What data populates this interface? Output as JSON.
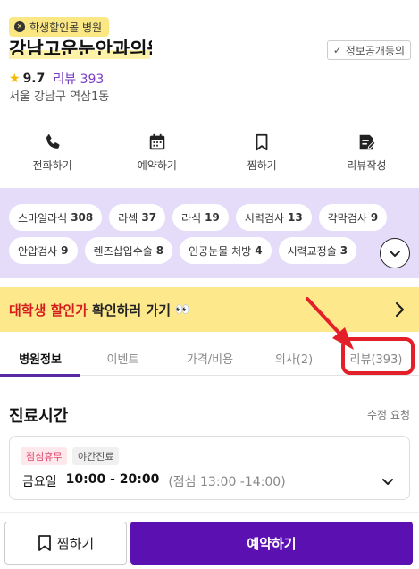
{
  "header": {
    "badge": "학생할인몰 병원",
    "name": "강남고운눈안과의원",
    "info_button": "정보공개동의",
    "rating": "9.7",
    "review_label": "리뷰 393",
    "address": "서울 강남구 역삼1동"
  },
  "actions": [
    {
      "label": "전화하기",
      "icon": "phone-icon"
    },
    {
      "label": "예약하기",
      "icon": "calendar-icon"
    },
    {
      "label": "찜하기",
      "icon": "bookmark-icon"
    },
    {
      "label": "리뷰작성",
      "icon": "review-write-icon"
    }
  ],
  "chips": {
    "row1": [
      {
        "name": "스마일라식",
        "count": "308"
      },
      {
        "name": "라섹",
        "count": "37"
      },
      {
        "name": "라식",
        "count": "19"
      },
      {
        "name": "시력검사",
        "count": "13"
      },
      {
        "name": "각막검사",
        "count": "9"
      }
    ],
    "row2": [
      {
        "name": "안압검사",
        "count": "9"
      },
      {
        "name": "렌즈삽입수술",
        "count": "8"
      },
      {
        "name": "인공눈물 처방",
        "count": "4"
      },
      {
        "name": "시력교정술",
        "count": "3"
      }
    ]
  },
  "banner": {
    "highlight": "대학생 할인가",
    "text": "확인하러 가기",
    "emoji": "👀"
  },
  "tabs": [
    {
      "label": "병원정보",
      "active": true
    },
    {
      "label": "이벤트",
      "active": false
    },
    {
      "label": "가격/비용",
      "active": false
    },
    {
      "label": "의사(2)",
      "active": false
    },
    {
      "label": "리뷰(393)",
      "active": false
    }
  ],
  "hours": {
    "title": "진료시간",
    "edit_link": "수정 요청",
    "tag_lunch": "점심휴무",
    "tag_night": "야간진료",
    "day": "금요일",
    "time": "10:00 - 20:00",
    "lunch": "(점심 13:00 -14:00)"
  },
  "bottom": {
    "bookmark_label": "찜하기",
    "book_label": "예약하기"
  },
  "colors": {
    "accent": "#5b10b2",
    "chips_bg": "#e4dcf8",
    "banner_bg": "#fde88c",
    "annotation": "#e3202a"
  }
}
